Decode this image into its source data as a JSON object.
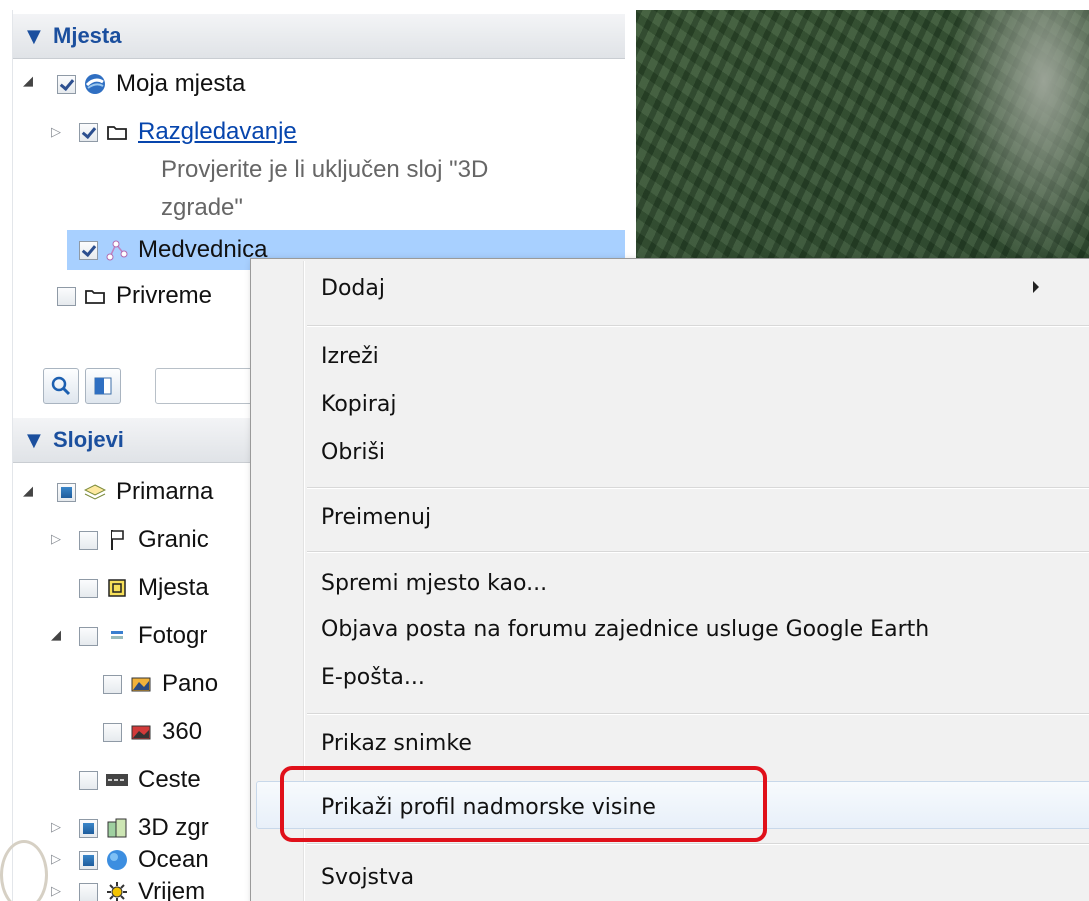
{
  "places_panel": {
    "title": "Mjesta",
    "items": [
      {
        "label": "Moja mjesta"
      },
      {
        "label": "Razgledavanje",
        "description": "Provjerite je li uključen sloj \"3D zgrade\""
      },
      {
        "label": "Medvednica"
      },
      {
        "label": "Privreme"
      }
    ],
    "desc_line1": "Provjerite je li uključen sloj \"3D",
    "desc_line2": "zgrade\""
  },
  "layers_panel": {
    "title": "Slojevi",
    "items": [
      {
        "label": "Primarna"
      },
      {
        "label": "Granic"
      },
      {
        "label": "Mjesta"
      },
      {
        "label": "Fotogr"
      },
      {
        "label": "Pano"
      },
      {
        "label": "360"
      },
      {
        "label": "Ceste"
      },
      {
        "label": "3D zgr"
      },
      {
        "label": "Ocean"
      },
      {
        "label": "Vrijem"
      }
    ]
  },
  "context_menu": {
    "items": [
      {
        "label": "Dodaj"
      },
      {
        "label": "Izreži"
      },
      {
        "label": "Kopiraj"
      },
      {
        "label": "Obriši"
      },
      {
        "label": "Preimenuj"
      },
      {
        "label": "Spremi mjesto kao..."
      },
      {
        "label": "Objava posta na forumu zajednice usluge Google Earth"
      },
      {
        "label": "E-pošta..."
      },
      {
        "label": "Prikaz snimke"
      },
      {
        "label": "Prikaži profil nadmorske visine"
      },
      {
        "label": "Svojstva"
      }
    ],
    "highlight_color": "#e0101a"
  },
  "icons": [
    "search-icon",
    "panel-toggle-icon",
    "earth-icon",
    "folder-icon",
    "path-icon",
    "layers-icon",
    "flag-icon",
    "place-marker-icon",
    "photo-icon",
    "panorama-icon",
    "road-icon",
    "building-icon",
    "ocean-icon",
    "weather-icon"
  ]
}
